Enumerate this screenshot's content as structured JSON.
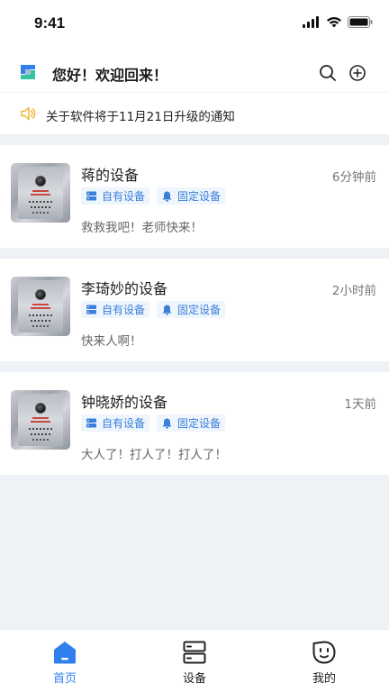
{
  "status_bar": {
    "time": "9:41"
  },
  "header": {
    "greeting": "您好！欢迎回来！",
    "logo_icon": "app-logo-icon",
    "search_icon": "search-icon",
    "add_icon": "plus-circle-icon"
  },
  "notice": {
    "icon": "speaker-icon",
    "text": "关于软件将于11月21日升级的通知"
  },
  "devices": [
    {
      "name": "蒋的设备",
      "time": "6分钟前",
      "tag_owned": "自有设备",
      "tag_fixed": "固定设备",
      "message": "救救我吧！老师快来！"
    },
    {
      "name": "李琦妙的设备",
      "time": "2小时前",
      "tag_owned": "自有设备",
      "tag_fixed": "固定设备",
      "message": "快来人啊！"
    },
    {
      "name": "钟晓娇的设备",
      "time": "1天前",
      "tag_owned": "自有设备",
      "tag_fixed": "固定设备",
      "message": "大人了！打人了！打人了！"
    }
  ],
  "tabs": [
    {
      "label": "首页",
      "icon": "home-icon",
      "active": true
    },
    {
      "label": "设备",
      "icon": "device-icon",
      "active": false
    },
    {
      "label": "我的",
      "icon": "profile-icon",
      "active": false
    }
  ],
  "colors": {
    "accent": "#2f80ed",
    "tag_bg": "#eef5fd",
    "notice_icon": "#f0b429",
    "page_bg": "#eef1f5"
  }
}
